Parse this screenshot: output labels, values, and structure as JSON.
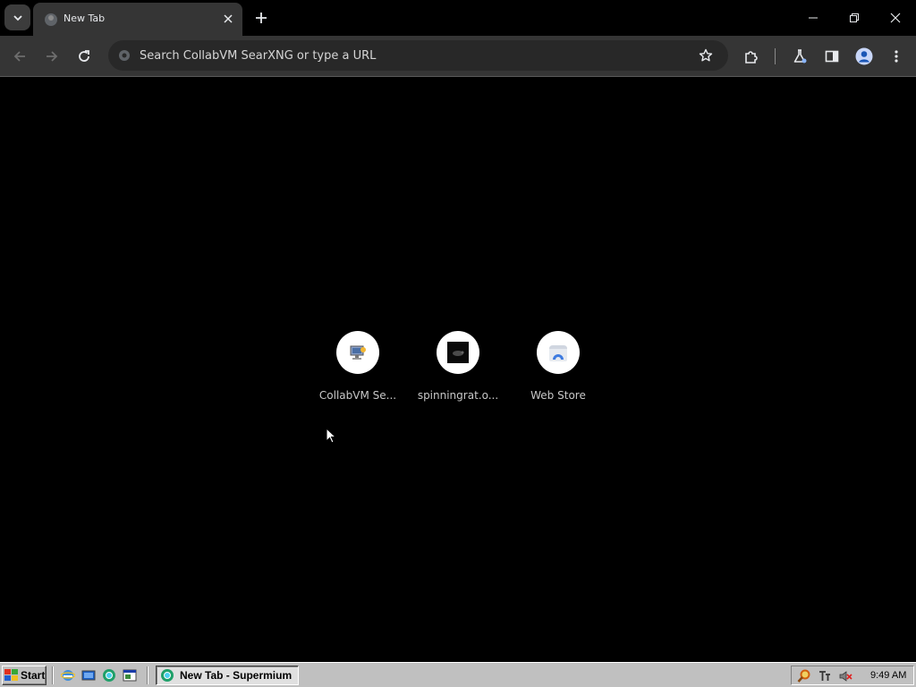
{
  "browser": {
    "tab": {
      "title": "New Tab"
    },
    "omnibox": {
      "placeholder": "Search CollabVM SearXNG or type a URL",
      "value": ""
    }
  },
  "shortcuts": [
    {
      "label": "CollabVM Se...",
      "icon": "collabvm-icon"
    },
    {
      "label": "spinningrat.o...",
      "icon": "spinningrat-icon"
    },
    {
      "label": "Web Store",
      "icon": "web-store-icon"
    }
  ],
  "taskbar": {
    "start_label": "Start",
    "task_label": "New Tab - Supermium",
    "clock": "9:49 AM"
  },
  "colors": {
    "page_background": "#000000",
    "tab_active": "#353535",
    "toolbar": "#353535",
    "omnibox": "#282828",
    "taskbar": "#c0c0c0"
  }
}
